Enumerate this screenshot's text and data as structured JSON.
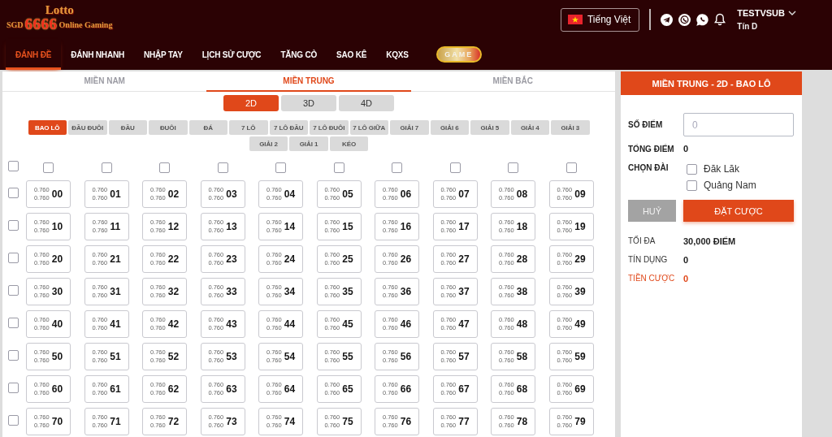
{
  "header": {
    "logo": {
      "title": "Lotto",
      "prefix": "SGD",
      "number": "6666",
      "tagline": "Online Gaming"
    },
    "language": {
      "label": "Tiếng Việt"
    },
    "user": {
      "name": "TESTVSUB",
      "credit": "Tín D"
    }
  },
  "nav": [
    {
      "label": "ĐÁNH ĐỀ",
      "selected": true
    },
    {
      "label": "ĐÁNH NHANH",
      "selected": false
    },
    {
      "label": "NHẬP TAY",
      "selected": false
    },
    {
      "label": "LỊCH SỬ CƯỢC",
      "selected": false
    },
    {
      "label": "TĂNG CÒ",
      "selected": false
    },
    {
      "label": "SAO KÊ",
      "selected": false
    },
    {
      "label": "KQXS",
      "selected": false
    }
  ],
  "game_button": {
    "label": "GAME"
  },
  "regions": [
    {
      "label": "MIỀN NAM",
      "selected": false
    },
    {
      "label": "MIỀN TRUNG",
      "selected": true
    },
    {
      "label": "MIỀN BẮC",
      "selected": false
    }
  ],
  "digit_types": [
    {
      "label": "2D",
      "selected": true
    },
    {
      "label": "3D",
      "selected": false
    },
    {
      "label": "4D",
      "selected": false
    }
  ],
  "bet_types": [
    {
      "label": "BAO LÔ",
      "selected": true
    },
    {
      "label": "ĐẦU ĐUÔI",
      "selected": false
    },
    {
      "label": "ĐẦU",
      "selected": false
    },
    {
      "label": "ĐUÔI",
      "selected": false
    },
    {
      "label": "ĐÁ",
      "selected": false
    },
    {
      "label": "7 LÔ",
      "selected": false
    },
    {
      "label": "7 LÔ ĐẦU",
      "selected": false
    },
    {
      "label": "7 LÔ ĐUÔI",
      "selected": false
    },
    {
      "label": "7 LÔ GIỮA",
      "selected": false
    },
    {
      "label": "GIẢI 7",
      "selected": false
    },
    {
      "label": "GIẢI 6",
      "selected": false
    },
    {
      "label": "GIẢI 5",
      "selected": false
    },
    {
      "label": "GIẢI 4",
      "selected": false
    },
    {
      "label": "GIẢI 3",
      "selected": false
    },
    {
      "label": "GIẢI 2",
      "selected": false
    },
    {
      "label": "GIẢI 1",
      "selected": false
    },
    {
      "label": "KÉO",
      "selected": false
    }
  ],
  "grid": {
    "select_all": {
      "checked": false
    },
    "columns": [
      {
        "checked": false
      },
      {
        "checked": false
      },
      {
        "checked": false
      },
      {
        "checked": false
      },
      {
        "checked": false
      },
      {
        "checked": false
      },
      {
        "checked": false
      },
      {
        "checked": false
      },
      {
        "checked": false
      },
      {
        "checked": false
      }
    ],
    "rows": [
      {
        "checked": false,
        "cells": [
          {
            "number": "00",
            "odds": [
              "0.760",
              "0.760"
            ]
          },
          {
            "number": "01",
            "odds": [
              "0.760",
              "0.760"
            ]
          },
          {
            "number": "02",
            "odds": [
              "0.760",
              "0.760"
            ]
          },
          {
            "number": "03",
            "odds": [
              "0.760",
              "0.760"
            ]
          },
          {
            "number": "04",
            "odds": [
              "0.760",
              "0.760"
            ]
          },
          {
            "number": "05",
            "odds": [
              "0.760",
              "0.760"
            ]
          },
          {
            "number": "06",
            "odds": [
              "0.760",
              "0.760"
            ]
          },
          {
            "number": "07",
            "odds": [
              "0.760",
              "0.760"
            ]
          },
          {
            "number": "08",
            "odds": [
              "0.760",
              "0.760"
            ]
          },
          {
            "number": "09",
            "odds": [
              "0.760",
              "0.760"
            ]
          }
        ]
      },
      {
        "checked": false,
        "cells": [
          {
            "number": "10",
            "odds": [
              "0.760",
              "0.760"
            ]
          },
          {
            "number": "11",
            "odds": [
              "0.760",
              "0.760"
            ]
          },
          {
            "number": "12",
            "odds": [
              "0.760",
              "0.760"
            ]
          },
          {
            "number": "13",
            "odds": [
              "0.760",
              "0.760"
            ]
          },
          {
            "number": "14",
            "odds": [
              "0.760",
              "0.760"
            ]
          },
          {
            "number": "15",
            "odds": [
              "0.760",
              "0.760"
            ]
          },
          {
            "number": "16",
            "odds": [
              "0.760",
              "0.760"
            ]
          },
          {
            "number": "17",
            "odds": [
              "0.760",
              "0.760"
            ]
          },
          {
            "number": "18",
            "odds": [
              "0.760",
              "0.760"
            ]
          },
          {
            "number": "19",
            "odds": [
              "0.760",
              "0.760"
            ]
          }
        ]
      },
      {
        "checked": false,
        "cells": [
          {
            "number": "20",
            "odds": [
              "0.760",
              "0.760"
            ]
          },
          {
            "number": "21",
            "odds": [
              "0.760",
              "0.760"
            ]
          },
          {
            "number": "22",
            "odds": [
              "0.760",
              "0.760"
            ]
          },
          {
            "number": "23",
            "odds": [
              "0.760",
              "0.760"
            ]
          },
          {
            "number": "24",
            "odds": [
              "0.760",
              "0.760"
            ]
          },
          {
            "number": "25",
            "odds": [
              "0.760",
              "0.760"
            ]
          },
          {
            "number": "26",
            "odds": [
              "0.760",
              "0.760"
            ]
          },
          {
            "number": "27",
            "odds": [
              "0.760",
              "0.760"
            ]
          },
          {
            "number": "28",
            "odds": [
              "0.760",
              "0.760"
            ]
          },
          {
            "number": "29",
            "odds": [
              "0.760",
              "0.760"
            ]
          }
        ]
      },
      {
        "checked": false,
        "cells": [
          {
            "number": "30",
            "odds": [
              "0.760",
              "0.760"
            ]
          },
          {
            "number": "31",
            "odds": [
              "0.760",
              "0.760"
            ]
          },
          {
            "number": "32",
            "odds": [
              "0.760",
              "0.760"
            ]
          },
          {
            "number": "33",
            "odds": [
              "0.760",
              "0.760"
            ]
          },
          {
            "number": "34",
            "odds": [
              "0.760",
              "0.760"
            ]
          },
          {
            "number": "35",
            "odds": [
              "0.760",
              "0.760"
            ]
          },
          {
            "number": "36",
            "odds": [
              "0.760",
              "0.760"
            ]
          },
          {
            "number": "37",
            "odds": [
              "0.760",
              "0.760"
            ]
          },
          {
            "number": "38",
            "odds": [
              "0.760",
              "0.760"
            ]
          },
          {
            "number": "39",
            "odds": [
              "0.760",
              "0.760"
            ]
          }
        ]
      },
      {
        "checked": false,
        "cells": [
          {
            "number": "40",
            "odds": [
              "0.760",
              "0.760"
            ]
          },
          {
            "number": "41",
            "odds": [
              "0.760",
              "0.760"
            ]
          },
          {
            "number": "42",
            "odds": [
              "0.760",
              "0.760"
            ]
          },
          {
            "number": "43",
            "odds": [
              "0.760",
              "0.760"
            ]
          },
          {
            "number": "44",
            "odds": [
              "0.760",
              "0.760"
            ]
          },
          {
            "number": "45",
            "odds": [
              "0.760",
              "0.760"
            ]
          },
          {
            "number": "46",
            "odds": [
              "0.760",
              "0.760"
            ]
          },
          {
            "number": "47",
            "odds": [
              "0.760",
              "0.760"
            ]
          },
          {
            "number": "48",
            "odds": [
              "0.760",
              "0.760"
            ]
          },
          {
            "number": "49",
            "odds": [
              "0.760",
              "0.760"
            ]
          }
        ]
      },
      {
        "checked": false,
        "cells": [
          {
            "number": "50",
            "odds": [
              "0.760",
              "0.760"
            ]
          },
          {
            "number": "51",
            "odds": [
              "0.760",
              "0.760"
            ]
          },
          {
            "number": "52",
            "odds": [
              "0.760",
              "0.760"
            ]
          },
          {
            "number": "53",
            "odds": [
              "0.760",
              "0.760"
            ]
          },
          {
            "number": "54",
            "odds": [
              "0.760",
              "0.760"
            ]
          },
          {
            "number": "55",
            "odds": [
              "0.760",
              "0.760"
            ]
          },
          {
            "number": "56",
            "odds": [
              "0.760",
              "0.760"
            ]
          },
          {
            "number": "57",
            "odds": [
              "0.760",
              "0.760"
            ]
          },
          {
            "number": "58",
            "odds": [
              "0.760",
              "0.760"
            ]
          },
          {
            "number": "59",
            "odds": [
              "0.760",
              "0.760"
            ]
          }
        ]
      },
      {
        "checked": false,
        "cells": [
          {
            "number": "60",
            "odds": [
              "0.760",
              "0.760"
            ]
          },
          {
            "number": "61",
            "odds": [
              "0.760",
              "0.760"
            ]
          },
          {
            "number": "62",
            "odds": [
              "0.760",
              "0.760"
            ]
          },
          {
            "number": "63",
            "odds": [
              "0.760",
              "0.760"
            ]
          },
          {
            "number": "64",
            "odds": [
              "0.760",
              "0.760"
            ]
          },
          {
            "number": "65",
            "odds": [
              "0.760",
              "0.760"
            ]
          },
          {
            "number": "66",
            "odds": [
              "0.760",
              "0.760"
            ]
          },
          {
            "number": "67",
            "odds": [
              "0.760",
              "0.760"
            ]
          },
          {
            "number": "68",
            "odds": [
              "0.760",
              "0.760"
            ]
          },
          {
            "number": "69",
            "odds": [
              "0.760",
              "0.760"
            ]
          }
        ]
      },
      {
        "checked": false,
        "cells": [
          {
            "number": "70",
            "odds": [
              "0.760",
              "0.760"
            ]
          },
          {
            "number": "71",
            "odds": [
              "0.760",
              "0.760"
            ]
          },
          {
            "number": "72",
            "odds": [
              "0.760",
              "0.760"
            ]
          },
          {
            "number": "73",
            "odds": [
              "0.760",
              "0.760"
            ]
          },
          {
            "number": "74",
            "odds": [
              "0.760",
              "0.760"
            ]
          },
          {
            "number": "75",
            "odds": [
              "0.760",
              "0.760"
            ]
          },
          {
            "number": "76",
            "odds": [
              "0.760",
              "0.760"
            ]
          },
          {
            "number": "77",
            "odds": [
              "0.760",
              "0.760"
            ]
          },
          {
            "number": "78",
            "odds": [
              "0.760",
              "0.760"
            ]
          },
          {
            "number": "79",
            "odds": [
              "0.760",
              "0.760"
            ]
          }
        ]
      }
    ]
  },
  "bet_slip": {
    "title": "MIỀN TRUNG - 2D - BAO LÔ",
    "points": {
      "label": "SỐ ĐIỂM",
      "placeholder": "0"
    },
    "total": {
      "label": "TỔNG ĐIỂM",
      "value": "0"
    },
    "stations": {
      "label": "CHỌN ĐÀI",
      "options": [
        {
          "label": "Đăk Lăk",
          "checked": false
        },
        {
          "label": "Quảng Nam",
          "checked": false
        }
      ]
    },
    "buttons": [
      {
        "label": "HUỶ",
        "kind": "cancel"
      },
      {
        "label": "ĐẶT CƯỢC",
        "kind": "submit"
      }
    ],
    "summary": [
      {
        "label": "TỐI ĐA",
        "value": "30,000 ĐIỂM",
        "highlight": false
      },
      {
        "label": "TÍN DỤNG",
        "value": "0",
        "highlight": false
      },
      {
        "label": "TIỀN CƯỢC",
        "value": "0",
        "highlight": true
      }
    ]
  }
}
